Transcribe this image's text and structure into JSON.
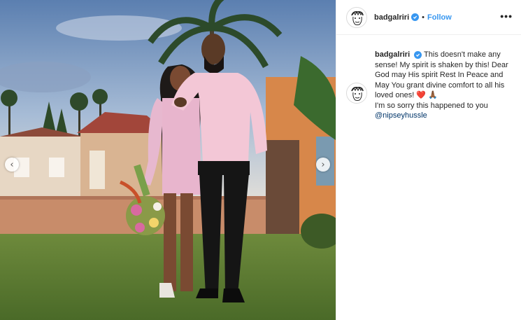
{
  "post": {
    "username": "badgalriri",
    "follow_label": "Follow",
    "separator": "•",
    "more_label": "•••",
    "verified_icon": "verified-check-icon"
  },
  "photo": {
    "alt": "Couple posing on a lawn",
    "prev_label": "‹",
    "next_label": "›"
  },
  "caption": {
    "username": "badgalriri",
    "text_line1": "This doesn't make any sense! My spirit is shaken by this! Dear God may His spirit Rest In Peace and May You grant divine comfort to all his loved ones!",
    "emoji": "❤️",
    "emoji2": "🙏🏾",
    "text_line2": "I'm so sorry this happened to you",
    "mention": "@nipseyhussle"
  },
  "colors": {
    "accent": "#3897f0",
    "mention": "#003569",
    "text": "#262626",
    "border": "#efefef"
  }
}
